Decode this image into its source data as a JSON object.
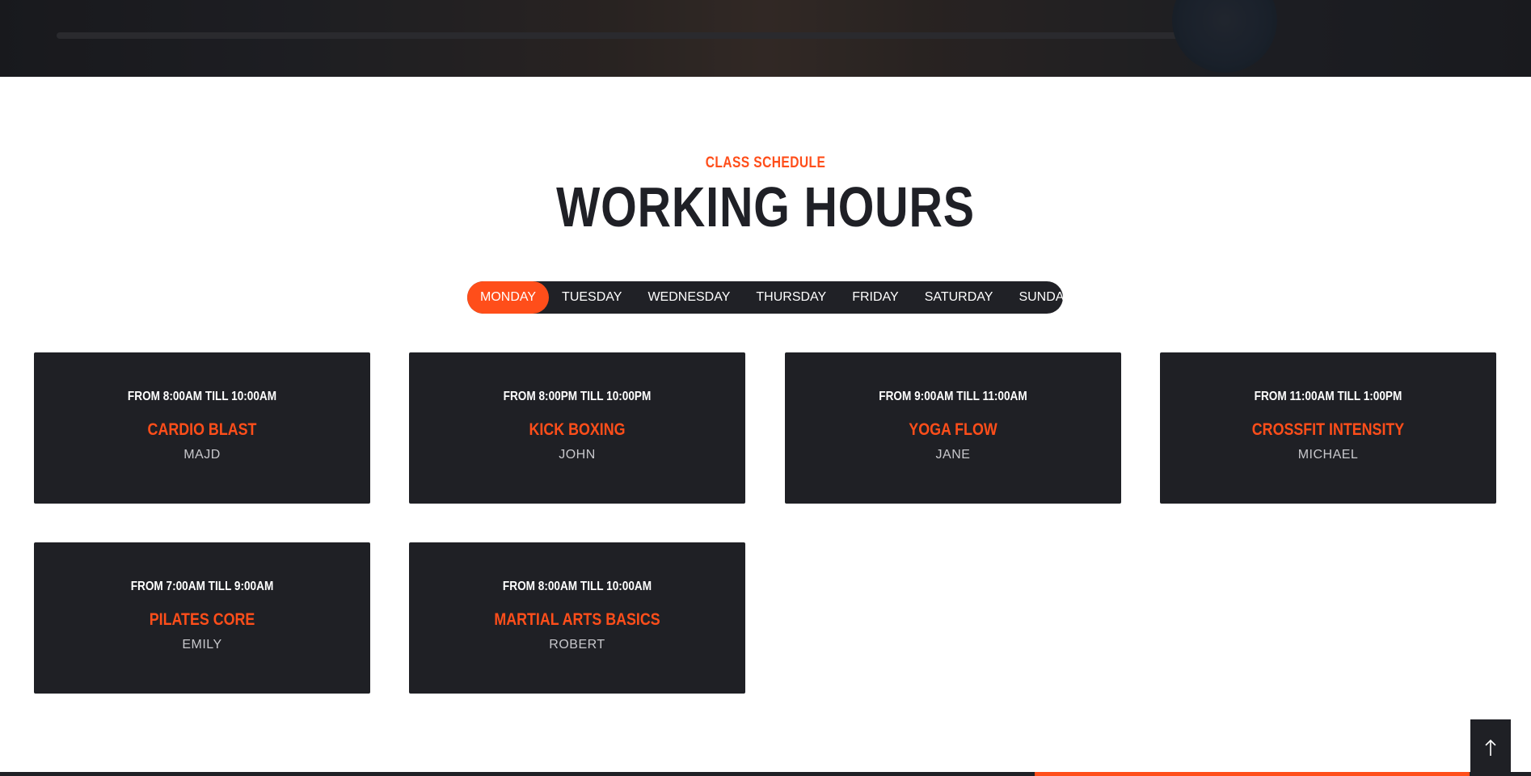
{
  "section": {
    "subtitle": "CLASS SCHEDULE",
    "title": "WORKING HOURS"
  },
  "tabs": [
    {
      "label": "MONDAY",
      "active": true
    },
    {
      "label": "TUESDAY",
      "active": false
    },
    {
      "label": "WEDNESDAY",
      "active": false
    },
    {
      "label": "THURSDAY",
      "active": false
    },
    {
      "label": "FRIDAY",
      "active": false
    },
    {
      "label": "SATURDAY",
      "active": false
    },
    {
      "label": "SUNDAY",
      "active": false
    }
  ],
  "classes": [
    {
      "time": "FROM 8:00AM TILL 10:00AM",
      "name": "CARDIO BLAST",
      "trainer": "MAJD"
    },
    {
      "time": "FROM 8:00PM TILL 10:00PM",
      "name": "KICK BOXING",
      "trainer": "JOHN"
    },
    {
      "time": "FROM 9:00AM TILL 11:00AM",
      "name": "YOGA FLOW",
      "trainer": "JANE"
    },
    {
      "time": "FROM 11:00AM TILL 1:00PM",
      "name": "CROSSFIT INTENSITY",
      "trainer": "MICHAEL"
    },
    {
      "time": "FROM 7:00AM TILL 9:00AM",
      "name": "PILATES CORE",
      "trainer": "EMILY"
    },
    {
      "time": "FROM 8:00AM TILL 10:00AM",
      "name": "MARTIAL ARTS BASICS",
      "trainer": "ROBERT"
    }
  ],
  "scroll_progress": {
    "fill_start_percent": 67.6,
    "fill_end_percent": 96
  },
  "scroll_to_top": {
    "icon": "arrow-up-icon"
  },
  "colors": {
    "accent": "#ff4e1a",
    "dark": "#1f2025",
    "white": "#ffffff"
  }
}
